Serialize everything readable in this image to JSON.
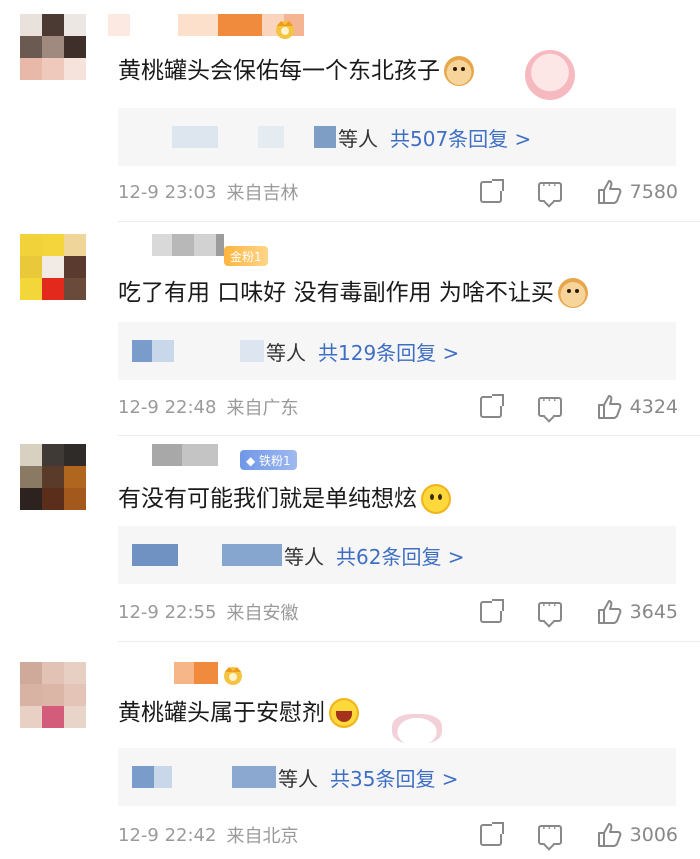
{
  "colors": {
    "link": "#3f6fc4",
    "meta": "#9a9a9a",
    "reply_bg": "#f6f6f6"
  },
  "comments": [
    {
      "text": "黄桃罐头会保佑每一个东北孩子",
      "emoji": "doge-icon",
      "reply_suffix": "等人",
      "reply_total": "共507条回复 >",
      "time": "12-9 23:03",
      "location": "来自吉林",
      "likes": "7580"
    },
    {
      "badge": "金粉1",
      "text": "吃了有用 口味好 没有毒副作用 为啥不让买",
      "emoji": "doge-icon",
      "reply_suffix": "等人",
      "reply_total": "共129条回复 >",
      "time": "12-9 22:48",
      "location": "来自广东",
      "likes": "4324"
    },
    {
      "badge": "◆ 铁粉1",
      "text": "有没有可能我们就是单纯想炫",
      "emoji": "smile-icon",
      "reply_suffix": "等人",
      "reply_total": "共62条回复 >",
      "time": "12-9 22:55",
      "location": "来自安徽",
      "likes": "3645"
    },
    {
      "text": "黄桃罐头属于安慰剂",
      "emoji": "laugh-icon",
      "reply_suffix": "等人",
      "reply_total": "共35条回复 >",
      "time": "12-9 22:42",
      "location": "来自北京",
      "likes": "3006"
    }
  ]
}
